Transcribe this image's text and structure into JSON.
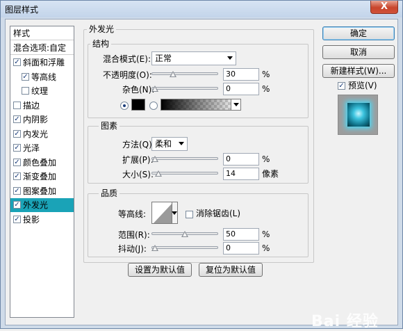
{
  "window": {
    "title": "图层样式",
    "close_glyph": "X"
  },
  "stylelist": {
    "header": "样式",
    "blend_options": "混合选项:自定",
    "items": [
      {
        "label": "斜面和浮雕",
        "checked": true,
        "indent": false
      },
      {
        "label": "等高线",
        "checked": true,
        "indent": true
      },
      {
        "label": "纹理",
        "checked": false,
        "indent": true
      },
      {
        "label": "描边",
        "checked": false,
        "indent": false
      },
      {
        "label": "内阴影",
        "checked": true,
        "indent": false
      },
      {
        "label": "内发光",
        "checked": true,
        "indent": false
      },
      {
        "label": "光泽",
        "checked": true,
        "indent": false
      },
      {
        "label": "颜色叠加",
        "checked": true,
        "indent": false
      },
      {
        "label": "渐变叠加",
        "checked": true,
        "indent": false
      },
      {
        "label": "图案叠加",
        "checked": true,
        "indent": false
      },
      {
        "label": "外发光",
        "checked": true,
        "indent": false,
        "selected": true
      },
      {
        "label": "投影",
        "checked": true,
        "indent": false
      }
    ],
    "selected_color": "#1aa3b7"
  },
  "panel": {
    "title": "外发光",
    "structure": {
      "title": "结构",
      "blend_mode_label": "混合模式(E):",
      "blend_mode_value": "正常",
      "opacity_label": "不透明度(O):",
      "opacity_value": "30",
      "noise_label": "杂色(N):",
      "noise_value": "0",
      "percent": "%",
      "opacity_level": 0.3,
      "noise_level": 0.0
    },
    "elements": {
      "title": "图素",
      "method_label": "方法(Q):",
      "method_value": "柔和",
      "spread_label": "扩展(P):",
      "spread_value": "0",
      "size_label": "大小(S):",
      "size_value": "14",
      "size_unit": "像素",
      "percent": "%",
      "spread_level": 0.0,
      "size_level": 0.06
    },
    "quality": {
      "title": "品质",
      "contour_label": "等高线:",
      "antialias_label": "消除锯齿(L)",
      "range_label": "范围(R):",
      "range_value": "50",
      "jitter_label": "抖动(J):",
      "jitter_value": "0",
      "percent": "%",
      "range_level": 0.5,
      "jitter_level": 0.0
    },
    "make_default": "设置为默认值",
    "reset_default": "复位为默认值"
  },
  "buttons": {
    "ok": "确定",
    "cancel": "取消",
    "new_style": "新建样式(W)...",
    "preview_label": "预览(V)"
  },
  "watermark": "Bai 经验"
}
